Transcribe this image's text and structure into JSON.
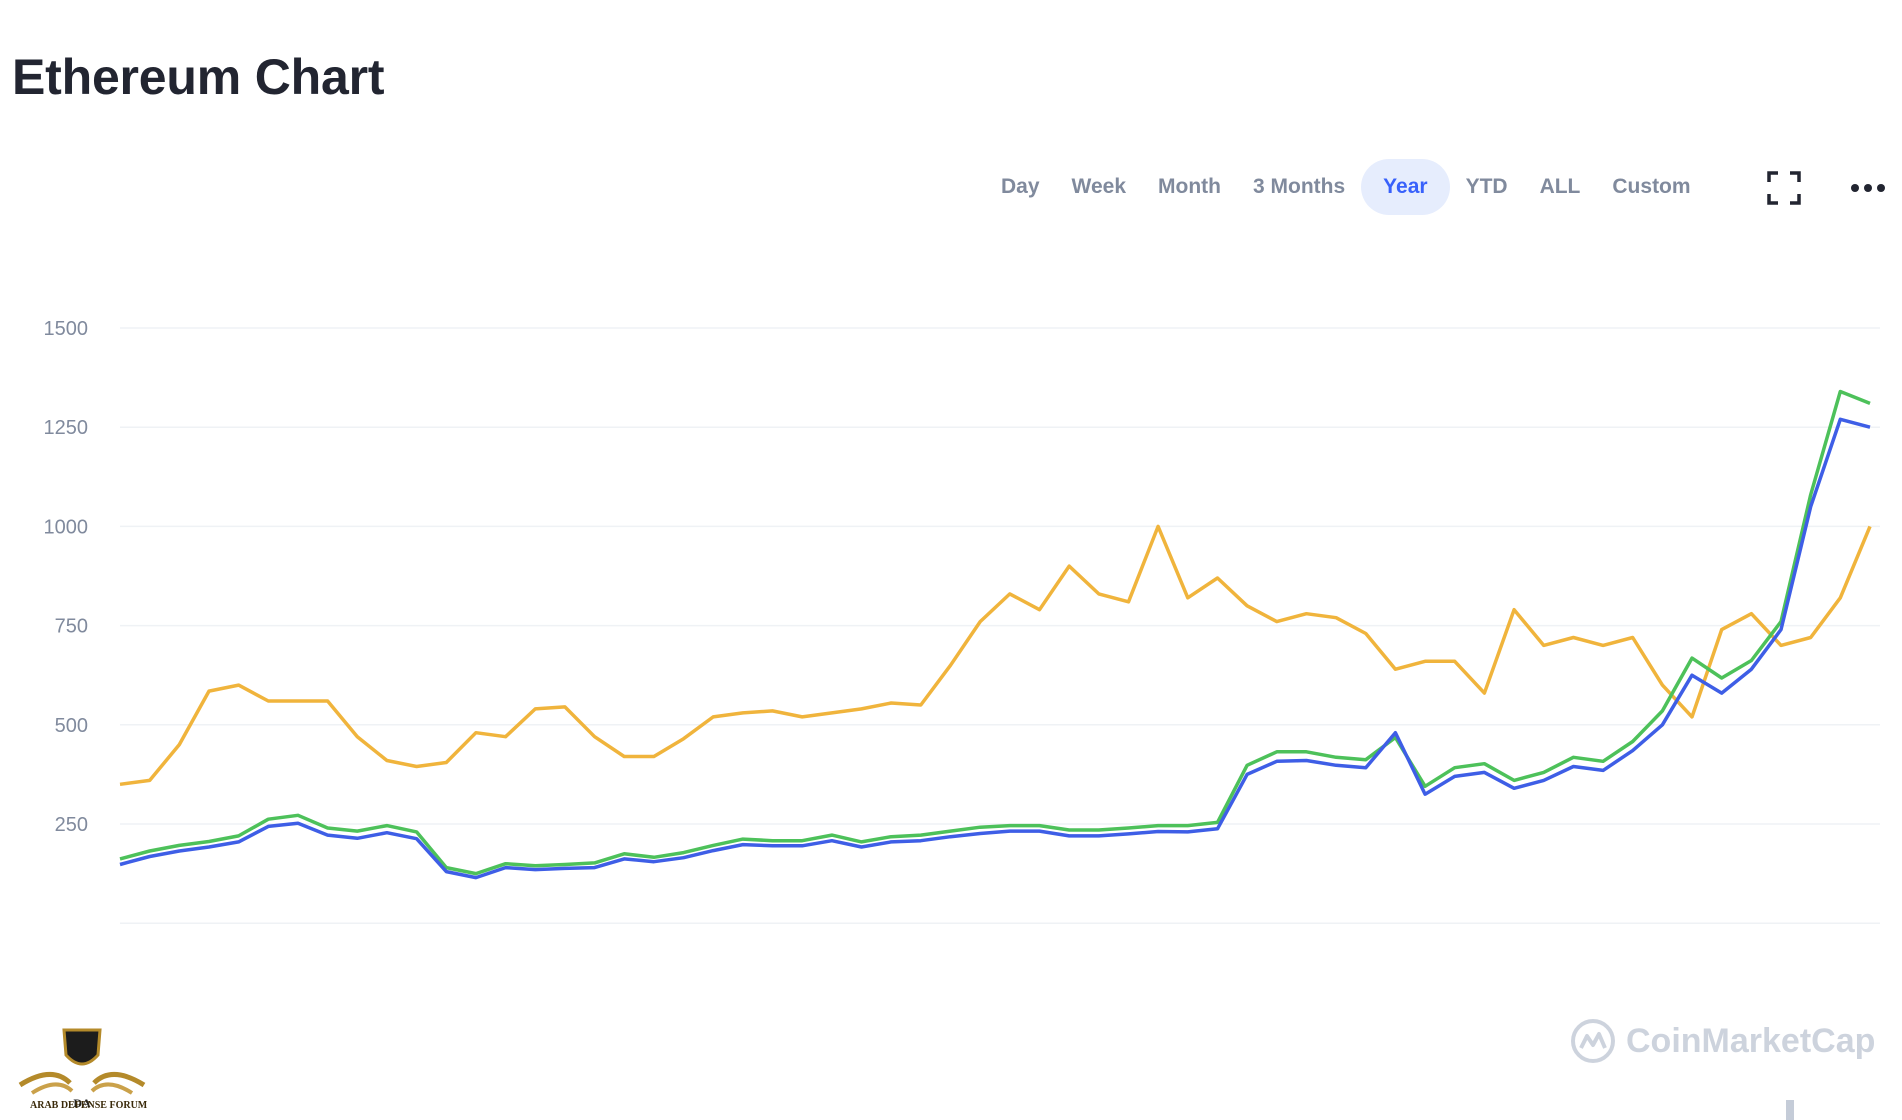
{
  "page": {
    "title": "Ethereum Chart"
  },
  "ranges": {
    "options": [
      "Day",
      "Week",
      "Month",
      "3 Months",
      "Year",
      "YTD",
      "ALL",
      "Custom"
    ],
    "active": "Year"
  },
  "icons": {
    "fullscreen": "fullscreen-icon",
    "more": "more-options-icon"
  },
  "watermark": {
    "text": "CoinMarketCap"
  },
  "forum_logo": {
    "text": "ARAB DEFENSE FORUM",
    "initials": "DA"
  },
  "colors": {
    "price_usd": "#3e5ee6",
    "price_btc": "#4dc15a",
    "volume": "#f0b43c",
    "grid": "#eff2f5",
    "axis_text": "#808a9d",
    "accent": "#3861fb"
  },
  "chart_data": {
    "type": "line",
    "title": "",
    "xlabel": "",
    "ylabel": "",
    "ylim": [
      0,
      1500
    ],
    "yticks": [
      250,
      500,
      750,
      1000,
      1250,
      1500
    ],
    "grid": true,
    "n_points": 60,
    "series": [
      {
        "values": [
          148,
          168,
          182,
          192,
          205,
          244,
          252,
          222,
          214,
          228,
          213,
          130,
          115,
          140,
          135,
          138,
          140,
          162,
          155,
          165,
          183,
          198,
          195,
          195,
          208,
          192,
          205,
          208,
          218,
          226,
          232,
          232,
          220,
          220,
          225,
          231,
          230,
          238,
          375,
          408,
          410,
          398,
          392,
          480,
          325,
          370,
          380,
          340,
          360,
          395,
          385,
          435,
          500,
          625,
          580,
          640,
          740,
          1050,
          1270,
          1250
        ]
      },
      {
        "values": [
          162,
          182,
          196,
          206,
          220,
          262,
          272,
          240,
          232,
          246,
          230,
          140,
          125,
          150,
          145,
          148,
          152,
          175,
          166,
          178,
          196,
          212,
          208,
          208,
          222,
          205,
          218,
          222,
          232,
          242,
          246,
          246,
          235,
          235,
          240,
          246,
          246,
          254,
          398,
          432,
          432,
          418,
          412,
          468,
          345,
          392,
          402,
          360,
          380,
          418,
          408,
          458,
          535,
          668,
          618,
          662,
          760,
          1080,
          1340,
          1310
        ]
      },
      {
        "values": [
          350,
          360,
          450,
          585,
          600,
          560,
          560,
          560,
          470,
          410,
          395,
          405,
          480,
          470,
          540,
          545,
          470,
          420,
          420,
          465,
          520,
          530,
          535,
          520,
          530,
          540,
          555,
          550,
          650,
          760,
          830,
          790,
          900,
          830,
          810,
          1000,
          820,
          870,
          800,
          760,
          780,
          770,
          730,
          640,
          660,
          660,
          580,
          790,
          700,
          720,
          700,
          720,
          600,
          520,
          740,
          780,
          700,
          720,
          820,
          1000
        ]
      }
    ]
  }
}
